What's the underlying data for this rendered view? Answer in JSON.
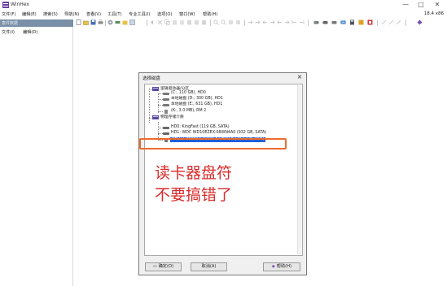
{
  "window": {
    "title": "WinHex",
    "version": "18.4 x86",
    "controls": {
      "minimize": "—",
      "maximize": "□",
      "close": "✕"
    }
  },
  "menu": [
    "文件(F)",
    "编辑(E)",
    "搜索(S)",
    "导航(N)",
    "查看(V)",
    "工具(T)",
    "专业工具(I)",
    "选项(O)",
    "窗口(W)",
    "帮助(H)"
  ],
  "left_panel": {
    "title": "案件数据",
    "menu": [
      "文件(I)",
      "编辑(D)"
    ]
  },
  "dialog": {
    "title": "选择磁盘",
    "close": "×",
    "tree": {
      "logical_group": "逻辑驱动器/分区",
      "logical_items": [
        "(C:, 110 GB), HD0",
        "本地磁盘 (D:, 300 GB), HD1",
        "本地磁盘 (E:, 631 GB), HD1",
        "(K:, 3.0 MB), RM 2"
      ],
      "physical_group": "物理存储介质",
      "physical_items": [
        "HD0: KingFast (119 GB, SATA)",
        "HD1: WDC WD10EZEX-08WN4A0 (932 GB, SATA)",
        "RM2: Generic STORAGE DEVICE (29.1 GB, USB)"
      ]
    },
    "buttons": {
      "ok": "确定(O)",
      "cancel": "取消(A)",
      "help": "帮助(H)"
    }
  },
  "annotation": "读卡器盘符\n不要搞错了",
  "colors": {
    "highlight": "#ee6a2e",
    "annotation": "#d92a2a",
    "selection": "#1f5fd6"
  }
}
